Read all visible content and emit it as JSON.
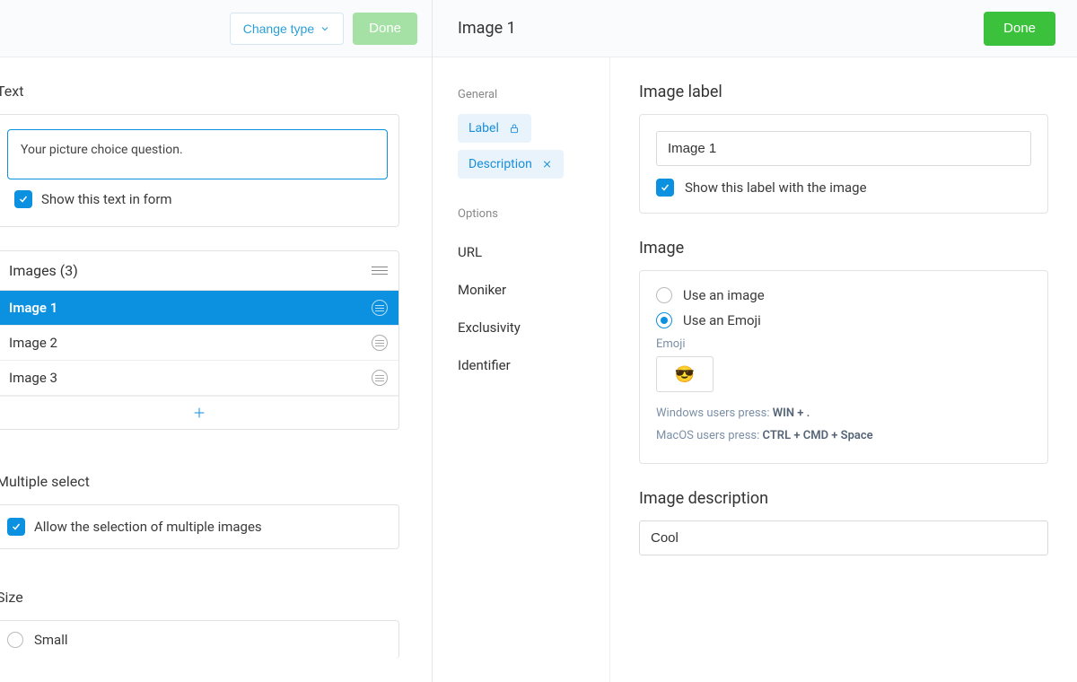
{
  "left": {
    "change_type_label": "Change type",
    "done_label": "Done",
    "text_section_title": "Text",
    "question_text": "Your picture choice question.",
    "show_text_label": "Show this text in form",
    "images_header": "Images (3)",
    "images": [
      {
        "label": "Image 1",
        "active": true
      },
      {
        "label": "Image 2",
        "active": false
      },
      {
        "label": "Image 3",
        "active": false
      }
    ],
    "multiple_select_title": "Multiple select",
    "allow_multiple_label": "Allow the selection of multiple images",
    "size_title": "Size",
    "size_options": [
      "Small"
    ]
  },
  "right_header": {
    "title": "Image 1",
    "done_label": "Done"
  },
  "nav": {
    "general_title": "General",
    "label_chip": "Label",
    "description_chip": "Description",
    "options_title": "Options",
    "options": [
      "URL",
      "Moniker",
      "Exclusivity",
      "Identifier"
    ]
  },
  "editor": {
    "image_label_title": "Image label",
    "image_label_value": "Image 1",
    "show_label_label": "Show this label with the image",
    "image_section_title": "Image",
    "use_image_label": "Use an image",
    "use_emoji_label": "Use an Emoji",
    "emoji_sub_label": "Emoji",
    "emoji_value": "😎",
    "hint_windows_prefix": "Windows users press: ",
    "hint_windows_keys": "WIN + .",
    "hint_macos_prefix": "MacOS users press: ",
    "hint_macos_keys": "CTRL + CMD + Space",
    "description_title": "Image description",
    "description_value": "Cool"
  }
}
